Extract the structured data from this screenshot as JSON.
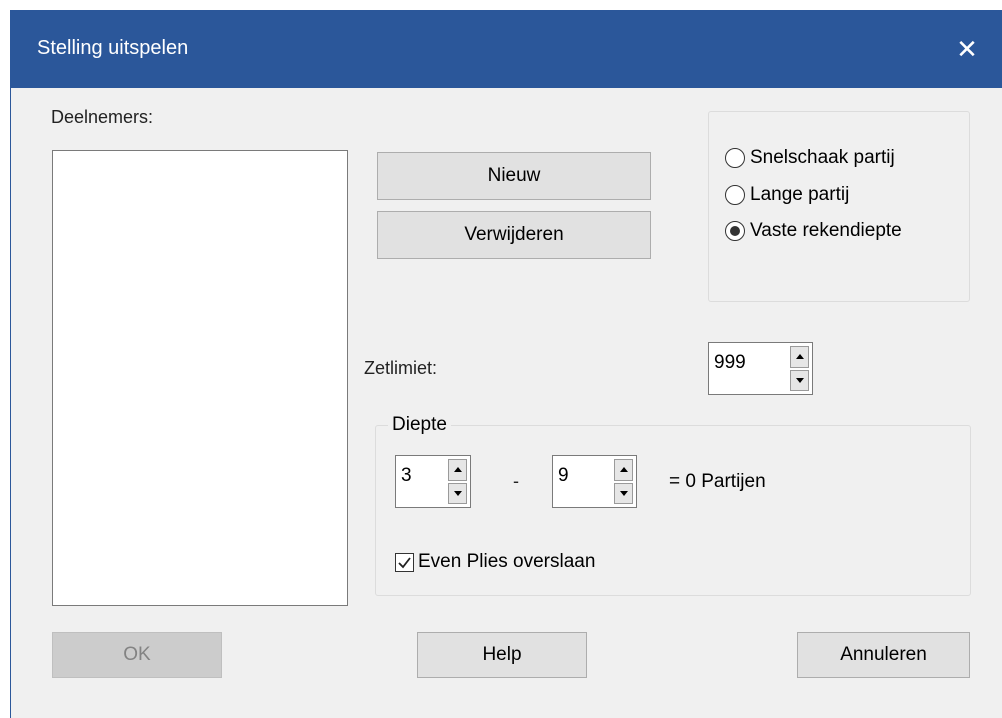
{
  "window": {
    "title": "Stelling uitspelen",
    "close_glyph": "✕"
  },
  "participants": {
    "label": "Deelnemers:"
  },
  "buttons": {
    "new": "Nieuw",
    "remove": "Verwijderen",
    "ok": "OK",
    "help": "Help",
    "cancel": "Annuleren"
  },
  "mode": {
    "options": [
      {
        "label": "Snelschaak partij",
        "selected": false
      },
      {
        "label": "Lange partij",
        "selected": false
      },
      {
        "label": "Vaste rekendiepte",
        "selected": true
      }
    ]
  },
  "move_limit": {
    "label": "Zetlimiet:",
    "value": "999"
  },
  "depth": {
    "legend": "Diepte",
    "from": "3",
    "separator": "-",
    "to": "9",
    "result": "= 0 Partijen",
    "skip_even_plies": {
      "label": "Even Plies overslaan",
      "checked": true
    }
  }
}
